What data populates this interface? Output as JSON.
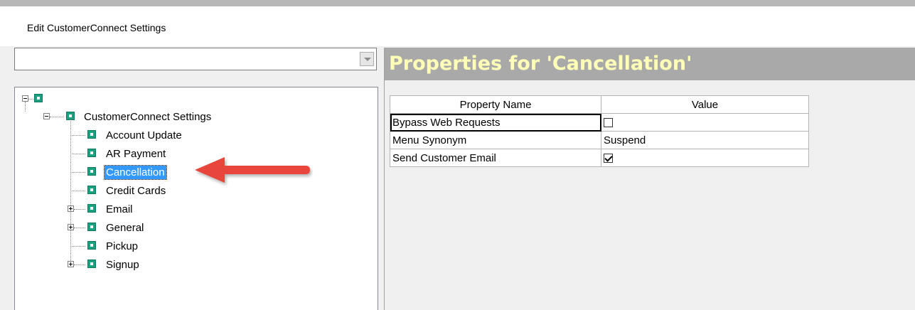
{
  "window": {
    "title": "Edit CustomerConnect Settings"
  },
  "combo": {
    "value": "",
    "icon": "chevron-down-icon"
  },
  "tree": {
    "root": {
      "label": ""
    },
    "settings": {
      "label": "CustomerConnect Settings"
    },
    "items": [
      {
        "label": "Account Update",
        "expander": "none",
        "selected": false
      },
      {
        "label": "AR Payment",
        "expander": "none",
        "selected": false
      },
      {
        "label": "Cancellation",
        "expander": "none",
        "selected": true
      },
      {
        "label": "Credit Cards",
        "expander": "none",
        "selected": false
      },
      {
        "label": "Email",
        "expander": "plus",
        "selected": false
      },
      {
        "label": "General",
        "expander": "plus",
        "selected": false
      },
      {
        "label": "Pickup",
        "expander": "none",
        "selected": false
      },
      {
        "label": "Signup",
        "expander": "plus",
        "selected": false
      }
    ]
  },
  "properties": {
    "title": "Properties for 'Cancellation'",
    "columns": [
      "Property Name",
      "Value"
    ],
    "rows": [
      {
        "name": "Bypass Web Requests",
        "type": "checkbox",
        "checked": false,
        "value": ""
      },
      {
        "name": "Menu Synonym",
        "type": "text",
        "value": "Suspend"
      },
      {
        "name": "Send Customer Email",
        "type": "checkbox",
        "checked": true,
        "value": ""
      }
    ]
  },
  "annotation": {
    "color": "#e8453c",
    "icon": "red-arrow-icon"
  },
  "colors": {
    "header_bg": "#a9a9a9",
    "header_text": "#ffffb7",
    "node_icon": "#1ca080",
    "selection": "#3399ff"
  }
}
